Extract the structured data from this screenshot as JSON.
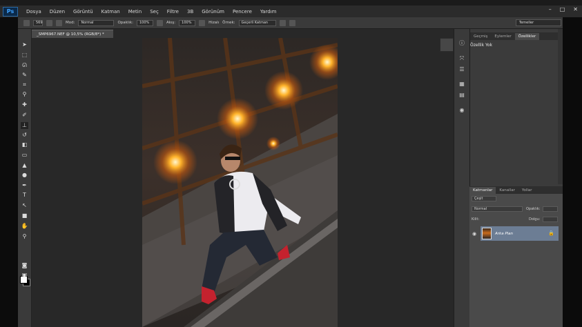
{
  "app": {
    "logo": "Ps"
  },
  "menubar": {
    "items": [
      "Dosya",
      "Düzen",
      "Görüntü",
      "Katman",
      "Metin",
      "Seç",
      "Filtre",
      "3B",
      "Görünüm",
      "Pencere",
      "Yardım"
    ],
    "window_controls": [
      "–",
      "□",
      "✕"
    ]
  },
  "options": {
    "mode_label": "Mod:",
    "mode_value": "Normal",
    "opacity_label": "Opaklık:",
    "opacity_value": "100%",
    "flow_label": "Akış:",
    "flow_value": "100%",
    "aligned_label": "Hizalı",
    "sample_label": "Örnek:",
    "sample_value": "Geçerli Katman",
    "brush_size": "569",
    "workspace": "Temeller"
  },
  "document": {
    "tab_title": "_SMP6967.NEF @ 10,5% (RGB/8*) *"
  },
  "properties_panel": {
    "tabs": [
      "Geçmiş",
      "Eylemler",
      "Özellikler"
    ],
    "active_tab": "Özellikler",
    "title": "Özellik Yok"
  },
  "layers_panel": {
    "tabs": [
      "Katmanlar",
      "Kanallar",
      "Yollar"
    ],
    "active_tab": "Katmanlar",
    "filter_value": "Çeşit",
    "blend_mode": "Normal",
    "opacity_label": "Opaklık:",
    "lock_label": "Kilit:",
    "fill_label": "Dolgu:",
    "layer_name": "Arka Plan"
  }
}
